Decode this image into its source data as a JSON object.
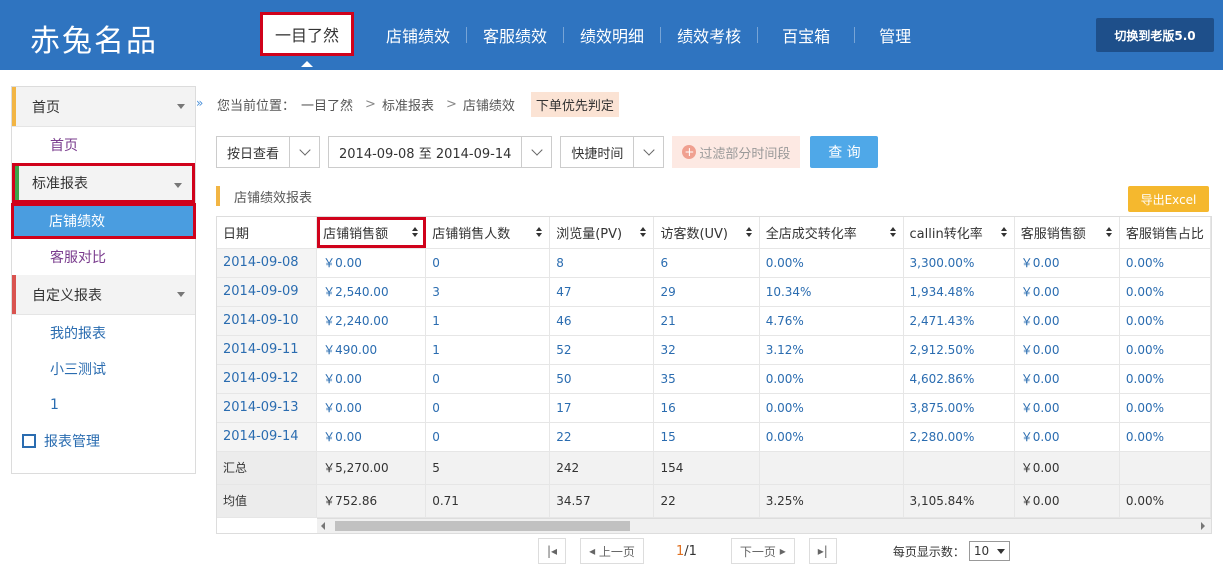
{
  "app": {
    "logo": "赤兔名品",
    "old_version_button": "切换到老版5.0"
  },
  "nav": [
    {
      "label": "一目了然"
    },
    {
      "label": "店铺绩效"
    },
    {
      "label": "客服绩效"
    },
    {
      "label": "绩效明细"
    },
    {
      "label": "绩效考核"
    },
    {
      "label": "百宝箱"
    },
    {
      "label": "管理"
    }
  ],
  "sidebar": {
    "home_group": "首页",
    "home_item": "首页",
    "std_group": "标准报表",
    "std_items": [
      "店铺绩效",
      "客服对比"
    ],
    "custom_group": "自定义报表",
    "custom_items": [
      "我的报表",
      "小三测试",
      "1"
    ],
    "manage": "报表管理",
    "colors": {
      "home_bar": "#f2b544",
      "std_bar": "#3aa64c",
      "custom_bar": "#d9534f"
    }
  },
  "breadcrumb": {
    "prefix": "您当前位置：",
    "path": [
      "一目了然",
      "标准报表",
      "店铺绩效"
    ],
    "tag": "下单优先判定"
  },
  "filters": {
    "view_by": "按日查看",
    "date_range": "2014-09-08 至 2014-09-14",
    "quick_time": "快捷时间",
    "filter_periods": "过滤部分时间段",
    "query": "查 询"
  },
  "section": {
    "title": "店铺绩效报表",
    "export": "导出Excel"
  },
  "table": {
    "headers": [
      "日期",
      "店铺销售额",
      "店铺销售人数",
      "浏览量(PV)",
      "访客数(UV)",
      "全店成交转化率",
      "callin转化率",
      "客服销售额",
      "客服销售占比"
    ],
    "rows": [
      [
        "2014-09-08",
        "￥0.00",
        "0",
        "8",
        "6",
        "0.00%",
        "3,300.00%",
        "￥0.00",
        "0.00%"
      ],
      [
        "2014-09-09",
        "￥2,540.00",
        "3",
        "47",
        "29",
        "10.34%",
        "1,934.48%",
        "￥0.00",
        "0.00%"
      ],
      [
        "2014-09-10",
        "￥2,240.00",
        "1",
        "46",
        "21",
        "4.76%",
        "2,471.43%",
        "￥0.00",
        "0.00%"
      ],
      [
        "2014-09-11",
        "￥490.00",
        "1",
        "52",
        "32",
        "3.12%",
        "2,912.50%",
        "￥0.00",
        "0.00%"
      ],
      [
        "2014-09-12",
        "￥0.00",
        "0",
        "50",
        "35",
        "0.00%",
        "4,602.86%",
        "￥0.00",
        "0.00%"
      ],
      [
        "2014-09-13",
        "￥0.00",
        "0",
        "17",
        "16",
        "0.00%",
        "3,875.00%",
        "￥0.00",
        "0.00%"
      ],
      [
        "2014-09-14",
        "￥0.00",
        "0",
        "22",
        "15",
        "0.00%",
        "2,280.00%",
        "￥0.00",
        "0.00%"
      ]
    ],
    "summary": [
      [
        "汇总",
        "￥5,270.00",
        "5",
        "242",
        "154",
        "",
        "",
        "￥0.00",
        ""
      ],
      [
        "均值",
        "￥752.86",
        "0.71",
        "34.57",
        "22",
        "3.25%",
        "3,105.84%",
        "￥0.00",
        "0.00%"
      ]
    ]
  },
  "pager": {
    "prev": "上一页",
    "next": "下一页",
    "current": "1",
    "total": "/1",
    "page_size_label": "每页显示数：",
    "page_size": "10"
  }
}
